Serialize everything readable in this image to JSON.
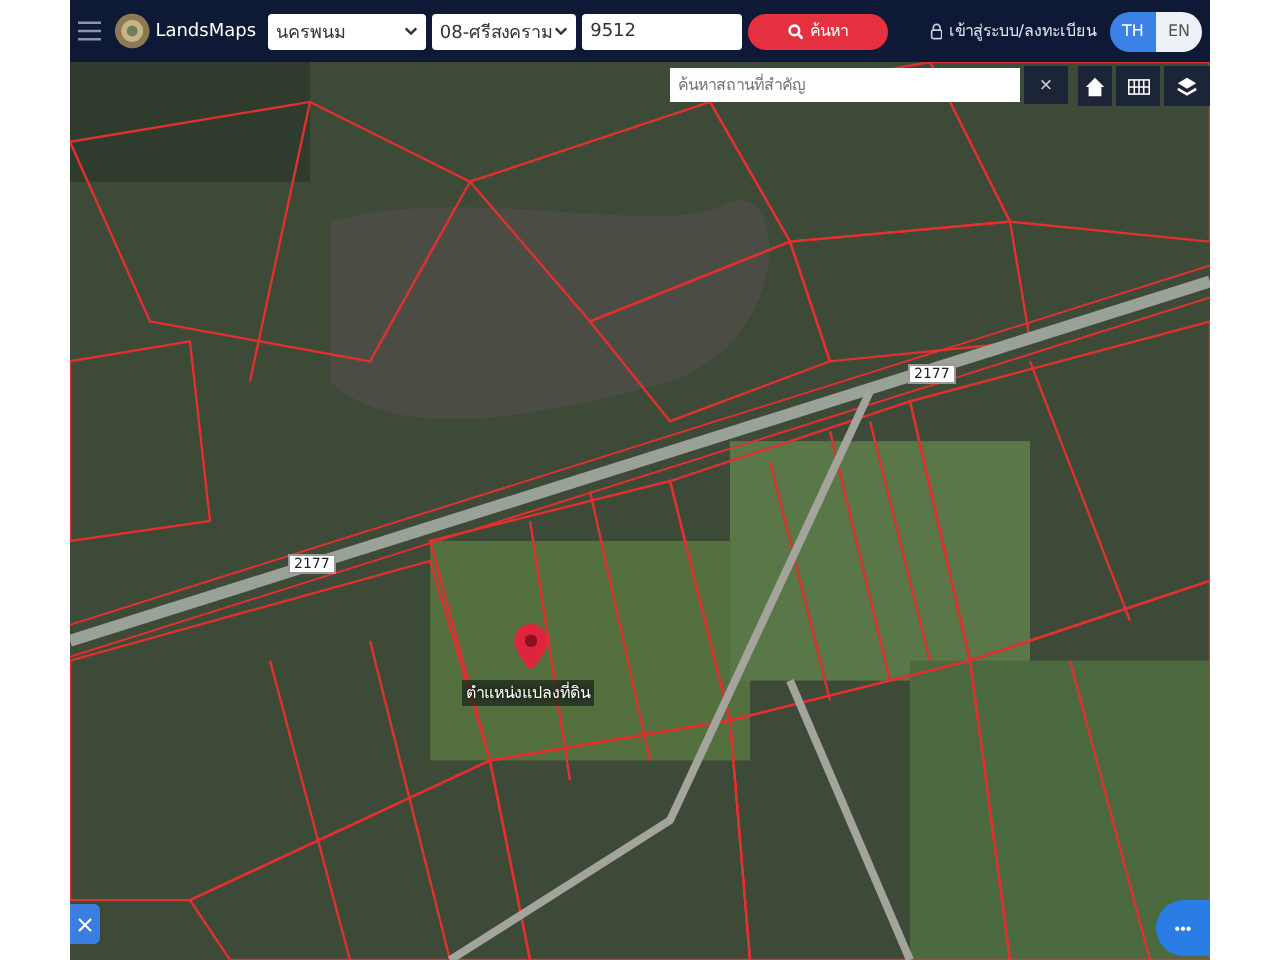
{
  "header": {
    "brand": "LandsMaps",
    "province": "นครพนม",
    "district": "08-ศรีสงคราม",
    "parcel_number": "9512",
    "search_button": "ค้นหา",
    "login": "เข้าสู่ระบบ/ลงทะเบียน",
    "languages": [
      {
        "label": "TH",
        "selected": true
      },
      {
        "label": "EN",
        "selected": false
      }
    ]
  },
  "map": {
    "place_search": {
      "placeholder": "ค้นหาสถานที่สำคัญ"
    },
    "close": "×",
    "road_labels": [
      "2177",
      "2177"
    ],
    "pin_label": "ตำแหน่งแปลงที่ดิน",
    "more": "•••"
  }
}
